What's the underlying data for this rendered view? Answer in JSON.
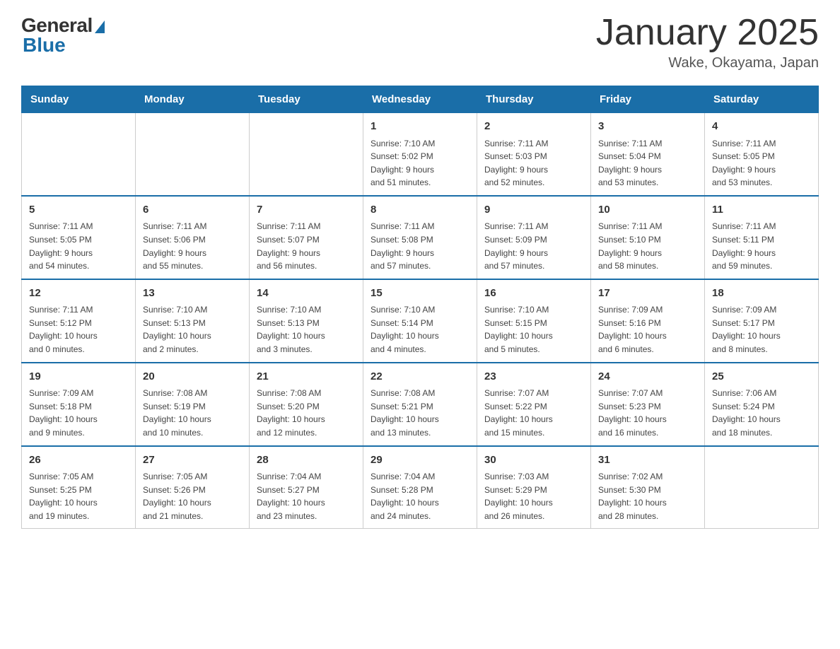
{
  "header": {
    "logo_general": "General",
    "logo_blue": "Blue",
    "title": "January 2025",
    "location": "Wake, Okayama, Japan"
  },
  "days_of_week": [
    "Sunday",
    "Monday",
    "Tuesday",
    "Wednesday",
    "Thursday",
    "Friday",
    "Saturday"
  ],
  "weeks": [
    {
      "days": [
        {
          "number": "",
          "info": ""
        },
        {
          "number": "",
          "info": ""
        },
        {
          "number": "",
          "info": ""
        },
        {
          "number": "1",
          "info": "Sunrise: 7:10 AM\nSunset: 5:02 PM\nDaylight: 9 hours\nand 51 minutes."
        },
        {
          "number": "2",
          "info": "Sunrise: 7:11 AM\nSunset: 5:03 PM\nDaylight: 9 hours\nand 52 minutes."
        },
        {
          "number": "3",
          "info": "Sunrise: 7:11 AM\nSunset: 5:04 PM\nDaylight: 9 hours\nand 53 minutes."
        },
        {
          "number": "4",
          "info": "Sunrise: 7:11 AM\nSunset: 5:05 PM\nDaylight: 9 hours\nand 53 minutes."
        }
      ]
    },
    {
      "days": [
        {
          "number": "5",
          "info": "Sunrise: 7:11 AM\nSunset: 5:05 PM\nDaylight: 9 hours\nand 54 minutes."
        },
        {
          "number": "6",
          "info": "Sunrise: 7:11 AM\nSunset: 5:06 PM\nDaylight: 9 hours\nand 55 minutes."
        },
        {
          "number": "7",
          "info": "Sunrise: 7:11 AM\nSunset: 5:07 PM\nDaylight: 9 hours\nand 56 minutes."
        },
        {
          "number": "8",
          "info": "Sunrise: 7:11 AM\nSunset: 5:08 PM\nDaylight: 9 hours\nand 57 minutes."
        },
        {
          "number": "9",
          "info": "Sunrise: 7:11 AM\nSunset: 5:09 PM\nDaylight: 9 hours\nand 57 minutes."
        },
        {
          "number": "10",
          "info": "Sunrise: 7:11 AM\nSunset: 5:10 PM\nDaylight: 9 hours\nand 58 minutes."
        },
        {
          "number": "11",
          "info": "Sunrise: 7:11 AM\nSunset: 5:11 PM\nDaylight: 9 hours\nand 59 minutes."
        }
      ]
    },
    {
      "days": [
        {
          "number": "12",
          "info": "Sunrise: 7:11 AM\nSunset: 5:12 PM\nDaylight: 10 hours\nand 0 minutes."
        },
        {
          "number": "13",
          "info": "Sunrise: 7:10 AM\nSunset: 5:13 PM\nDaylight: 10 hours\nand 2 minutes."
        },
        {
          "number": "14",
          "info": "Sunrise: 7:10 AM\nSunset: 5:13 PM\nDaylight: 10 hours\nand 3 minutes."
        },
        {
          "number": "15",
          "info": "Sunrise: 7:10 AM\nSunset: 5:14 PM\nDaylight: 10 hours\nand 4 minutes."
        },
        {
          "number": "16",
          "info": "Sunrise: 7:10 AM\nSunset: 5:15 PM\nDaylight: 10 hours\nand 5 minutes."
        },
        {
          "number": "17",
          "info": "Sunrise: 7:09 AM\nSunset: 5:16 PM\nDaylight: 10 hours\nand 6 minutes."
        },
        {
          "number": "18",
          "info": "Sunrise: 7:09 AM\nSunset: 5:17 PM\nDaylight: 10 hours\nand 8 minutes."
        }
      ]
    },
    {
      "days": [
        {
          "number": "19",
          "info": "Sunrise: 7:09 AM\nSunset: 5:18 PM\nDaylight: 10 hours\nand 9 minutes."
        },
        {
          "number": "20",
          "info": "Sunrise: 7:08 AM\nSunset: 5:19 PM\nDaylight: 10 hours\nand 10 minutes."
        },
        {
          "number": "21",
          "info": "Sunrise: 7:08 AM\nSunset: 5:20 PM\nDaylight: 10 hours\nand 12 minutes."
        },
        {
          "number": "22",
          "info": "Sunrise: 7:08 AM\nSunset: 5:21 PM\nDaylight: 10 hours\nand 13 minutes."
        },
        {
          "number": "23",
          "info": "Sunrise: 7:07 AM\nSunset: 5:22 PM\nDaylight: 10 hours\nand 15 minutes."
        },
        {
          "number": "24",
          "info": "Sunrise: 7:07 AM\nSunset: 5:23 PM\nDaylight: 10 hours\nand 16 minutes."
        },
        {
          "number": "25",
          "info": "Sunrise: 7:06 AM\nSunset: 5:24 PM\nDaylight: 10 hours\nand 18 minutes."
        }
      ]
    },
    {
      "days": [
        {
          "number": "26",
          "info": "Sunrise: 7:05 AM\nSunset: 5:25 PM\nDaylight: 10 hours\nand 19 minutes."
        },
        {
          "number": "27",
          "info": "Sunrise: 7:05 AM\nSunset: 5:26 PM\nDaylight: 10 hours\nand 21 minutes."
        },
        {
          "number": "28",
          "info": "Sunrise: 7:04 AM\nSunset: 5:27 PM\nDaylight: 10 hours\nand 23 minutes."
        },
        {
          "number": "29",
          "info": "Sunrise: 7:04 AM\nSunset: 5:28 PM\nDaylight: 10 hours\nand 24 minutes."
        },
        {
          "number": "30",
          "info": "Sunrise: 7:03 AM\nSunset: 5:29 PM\nDaylight: 10 hours\nand 26 minutes."
        },
        {
          "number": "31",
          "info": "Sunrise: 7:02 AM\nSunset: 5:30 PM\nDaylight: 10 hours\nand 28 minutes."
        },
        {
          "number": "",
          "info": ""
        }
      ]
    }
  ]
}
